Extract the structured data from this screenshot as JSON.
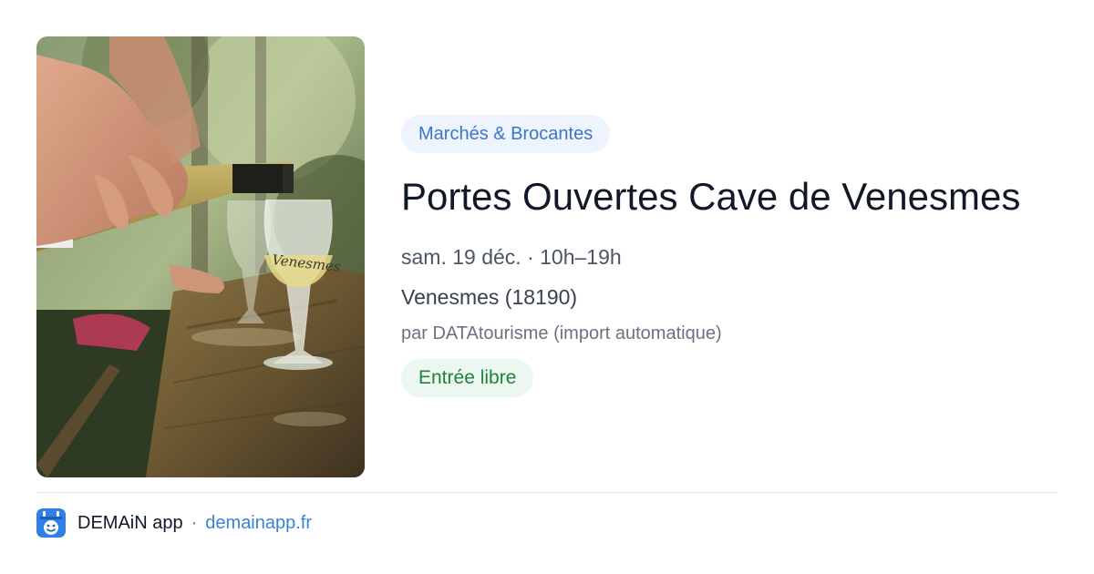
{
  "event": {
    "category": "Marchés & Brocantes",
    "title": "Portes Ouvertes Cave de Venesmes",
    "datetime": "sam. 19 déc. · 10h–19h",
    "location": "Venesmes (18190)",
    "organizer": "par DATAtourisme (import automatique)",
    "price": "Entrée libre",
    "photo": {
      "subject": "wine-pouring-photo",
      "glass_text": "Venesmes"
    }
  },
  "footer": {
    "app_name": "DEMAiN app",
    "separator": "·",
    "website": "demainapp.fr"
  },
  "colors": {
    "category_bg": "#eef4fd",
    "category_text": "#3b76c9",
    "price_bg": "#ecf7ef",
    "price_text": "#23803d",
    "link": "#3b82d6",
    "logo_blue": "#2f7fe6"
  }
}
